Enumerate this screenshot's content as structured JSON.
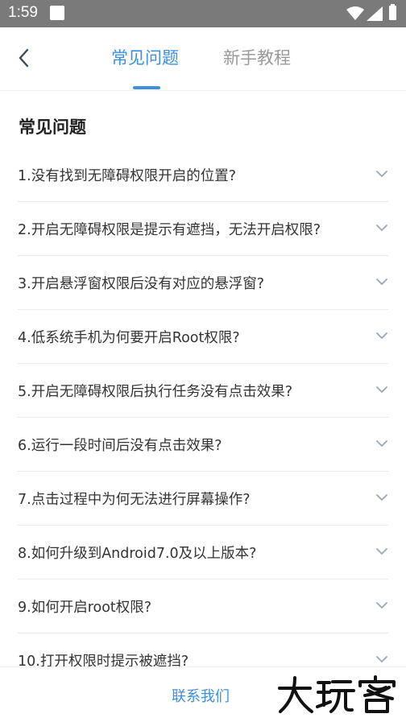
{
  "status_bar": {
    "time": "1:59"
  },
  "header": {
    "tabs": [
      {
        "label": "常见问题",
        "active": true
      },
      {
        "label": "新手教程",
        "active": false
      }
    ],
    "accent_color": "#3d8fe0"
  },
  "section": {
    "title": "常见问题"
  },
  "faq": [
    "1.没有找到无障碍权限开启的位置?",
    "2.开启无障碍权限是提示有遮挡，无法开启权限?",
    "3.开启悬浮窗权限后没有对应的悬浮窗?",
    "4.低系统手机为何要开启Root权限?",
    "5.开启无障碍权限后执行任务没有点击效果?",
    "6.运行一段时间后没有点击效果?",
    "7.点击过程中为何无法进行屏幕操作?",
    "8.如何升级到Android7.0及以上版本?",
    "9.如何开启root权限?",
    "10.打开权限时提示被遮挡?"
  ],
  "footer": {
    "contact_label": "联系我们"
  },
  "watermark": {
    "text": "大玩客"
  }
}
